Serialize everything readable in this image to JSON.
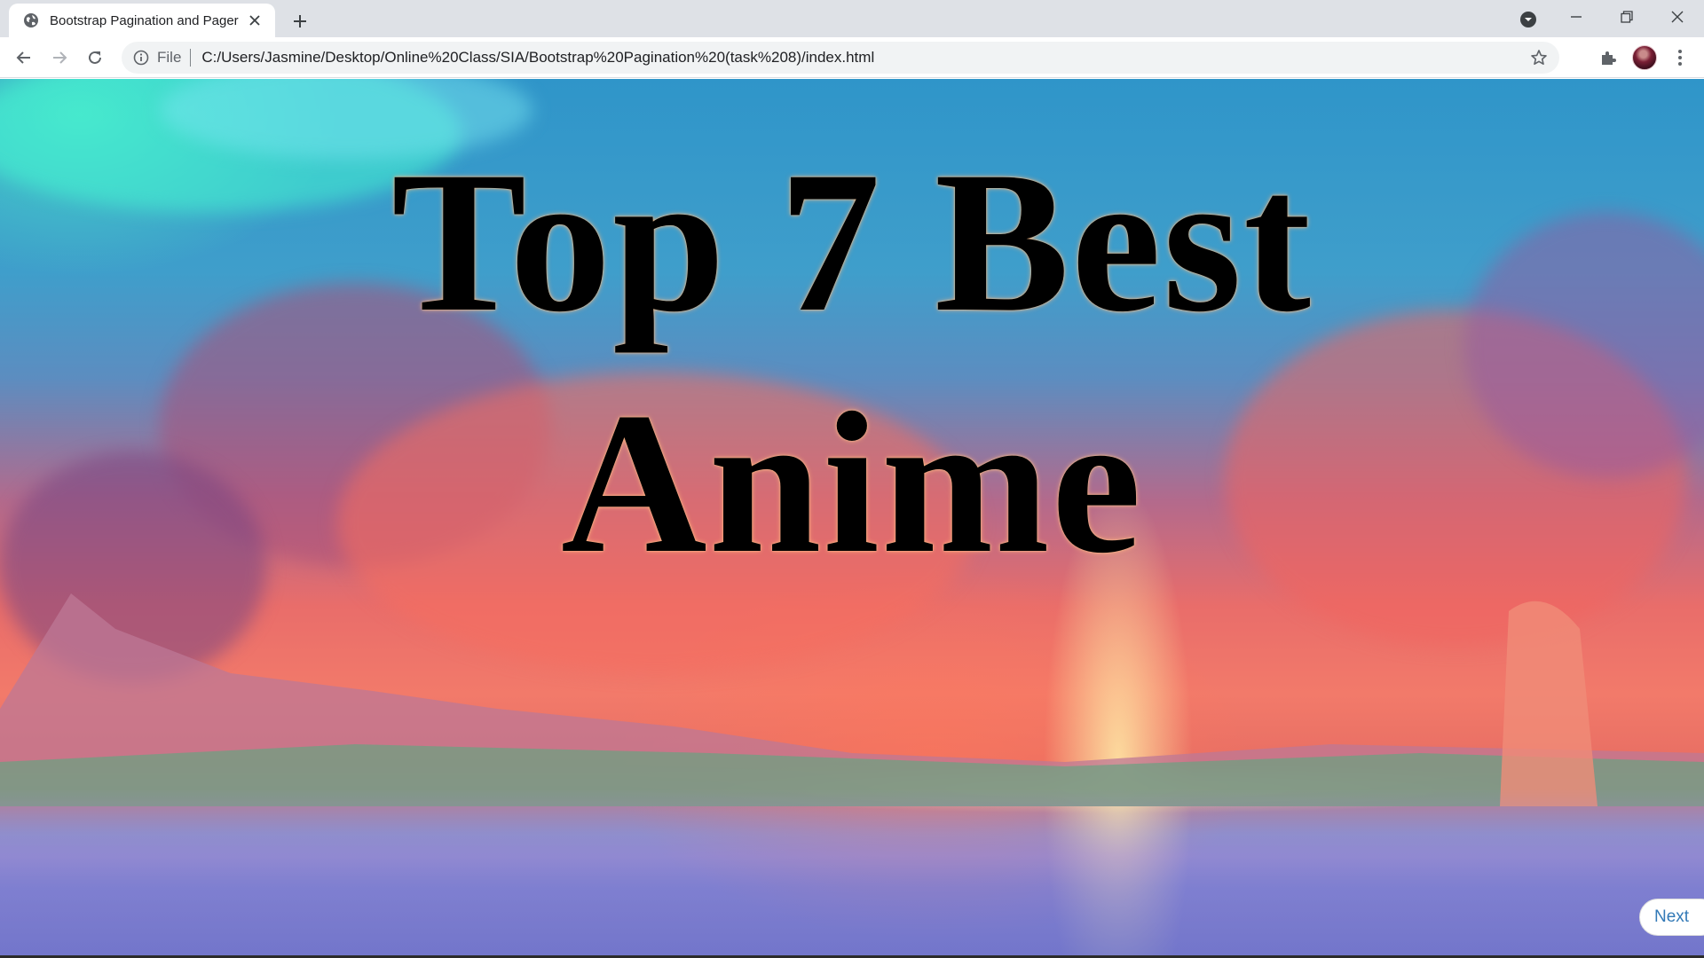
{
  "browser": {
    "tab": {
      "title": "Bootstrap Pagination and Pager",
      "favicon_icon": "globe-icon"
    },
    "address_bar": {
      "scheme_label": "File",
      "url": "C:/Users/Jasmine/Desktop/Online%20Class/SIA/Bootstrap%20Pagination%20(task%208)/index.html"
    },
    "icons": {
      "back": "back-arrow-icon",
      "forward": "forward-arrow-icon",
      "reload": "reload-icon",
      "info": "info-icon",
      "bookmark": "star-icon",
      "extensions": "puzzle-icon",
      "menu": "kebab-menu-icon"
    }
  },
  "page": {
    "headline_line1": "Top 7 Best",
    "headline_line2": "Anime",
    "pager": {
      "next_label": "Next"
    }
  },
  "colors": {
    "link": "#337ab7",
    "headline": "#000000",
    "chrome_tabstrip": "#dee1e6",
    "omnibox": "#f1f3f4"
  }
}
